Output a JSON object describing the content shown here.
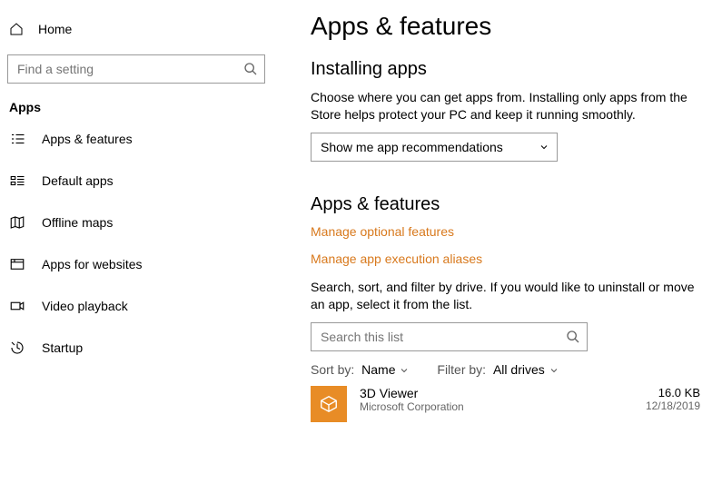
{
  "left": {
    "home": "Home",
    "search_placeholder": "Find a setting",
    "section_title": "Apps",
    "nav": [
      {
        "label": "Apps & features"
      },
      {
        "label": "Default apps"
      },
      {
        "label": "Offline maps"
      },
      {
        "label": "Apps for websites"
      },
      {
        "label": "Video playback"
      },
      {
        "label": "Startup"
      }
    ]
  },
  "right": {
    "title": "Apps & features",
    "installing_heading": "Installing apps",
    "installing_text": "Choose where you can get apps from. Installing only apps from the Store helps protect your PC and keep it running smoothly.",
    "dropdown_value": "Show me app recommendations",
    "apps_heading": "Apps & features",
    "link1": "Manage optional features",
    "link2": "Manage app execution aliases",
    "search_help": "Search, sort, and filter by drive. If you would like to uninstall or move an app, select it from the list.",
    "list_search_placeholder": "Search this list",
    "sort_label": "Sort by:",
    "sort_value": "Name",
    "filter_label": "Filter by:",
    "filter_value": "All drives",
    "app": {
      "name": "3D Viewer",
      "publisher": "Microsoft Corporation",
      "size": "16.0 KB",
      "date": "12/18/2019"
    }
  }
}
